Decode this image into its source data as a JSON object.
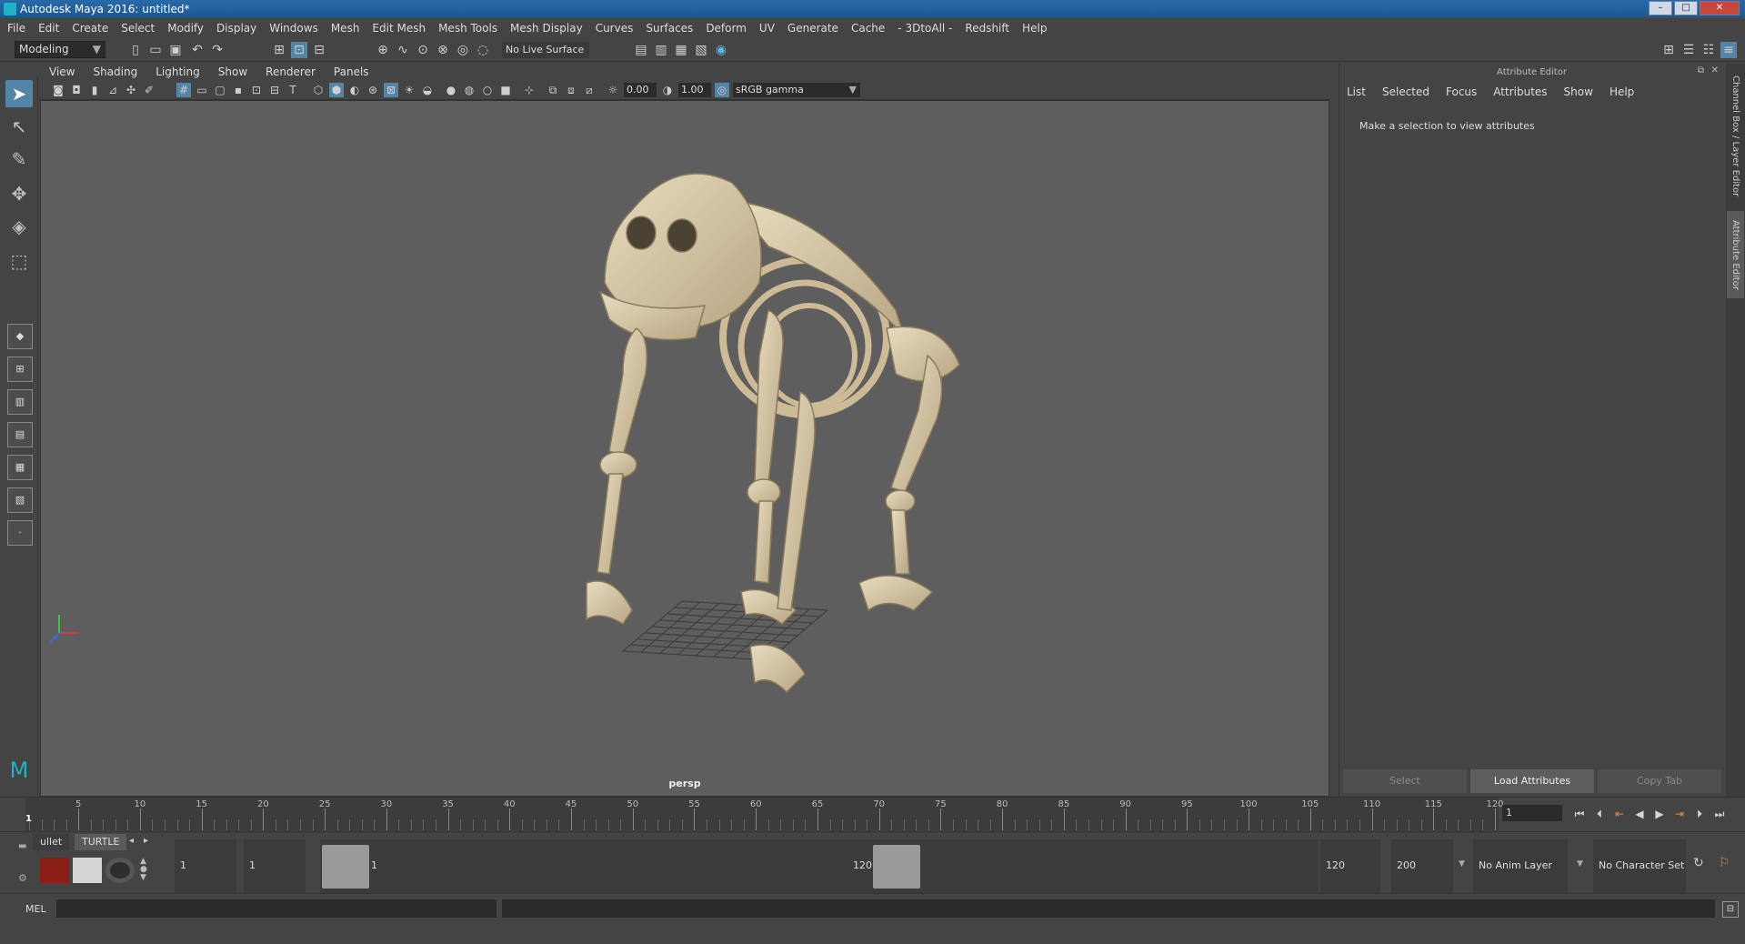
{
  "window": {
    "title": "Autodesk Maya 2016: untitled*",
    "minimize": "–",
    "maximize": "□",
    "close": "✕"
  },
  "menus": [
    "File",
    "Edit",
    "Create",
    "Select",
    "Modify",
    "Display",
    "Windows",
    "Mesh",
    "Edit Mesh",
    "Mesh Tools",
    "Mesh Display",
    "Curves",
    "Surfaces",
    "Deform",
    "UV",
    "Generate",
    "Cache",
    "- 3DtoAll -",
    "Redshift",
    "Help"
  ],
  "statusline": {
    "mode": "Modeling",
    "live_surface": "No Live Surface"
  },
  "viewport": {
    "menus": [
      "View",
      "Shading",
      "Lighting",
      "Show",
      "Renderer",
      "Panels"
    ],
    "exposure": "0.00",
    "gamma": "1.00",
    "color_space": "sRGB gamma",
    "camera": "persp"
  },
  "attribute_editor": {
    "title": "Attribute Editor",
    "menus": [
      "List",
      "Selected",
      "Focus",
      "Attributes",
      "Show",
      "Help"
    ],
    "message": "Make a selection to view attributes",
    "buttons": [
      "Select",
      "Load Attributes",
      "Copy Tab"
    ]
  },
  "side_tabs": [
    "Channel Box / Layer Editor",
    "Attribute Editor"
  ],
  "timeslider": {
    "ticks": [
      "5",
      "10",
      "15",
      "20",
      "25",
      "30",
      "35",
      "40",
      "45",
      "50",
      "55",
      "60",
      "65",
      "70",
      "75",
      "80",
      "85",
      "90",
      "95",
      "100",
      "105",
      "110",
      "115",
      "120"
    ],
    "current_frame": "1",
    "start_marker": "1"
  },
  "shelf": {
    "tabs": [
      "ullet",
      "TURTLE"
    ]
  },
  "range": {
    "start_time": "1",
    "playback_start": "1",
    "range_start_label": "1",
    "range_end_label": "120",
    "playback_end": "120",
    "end_time": "200",
    "anim_layer": "No Anim Layer",
    "character_set": "No Character Set"
  },
  "command_line": {
    "label": "MEL",
    "value": ""
  },
  "colors": {
    "accent": "#5285a6",
    "viewport_bg": "#5e5e5e",
    "bone": "#d9c9a8",
    "title_bar": "#1b5590"
  }
}
